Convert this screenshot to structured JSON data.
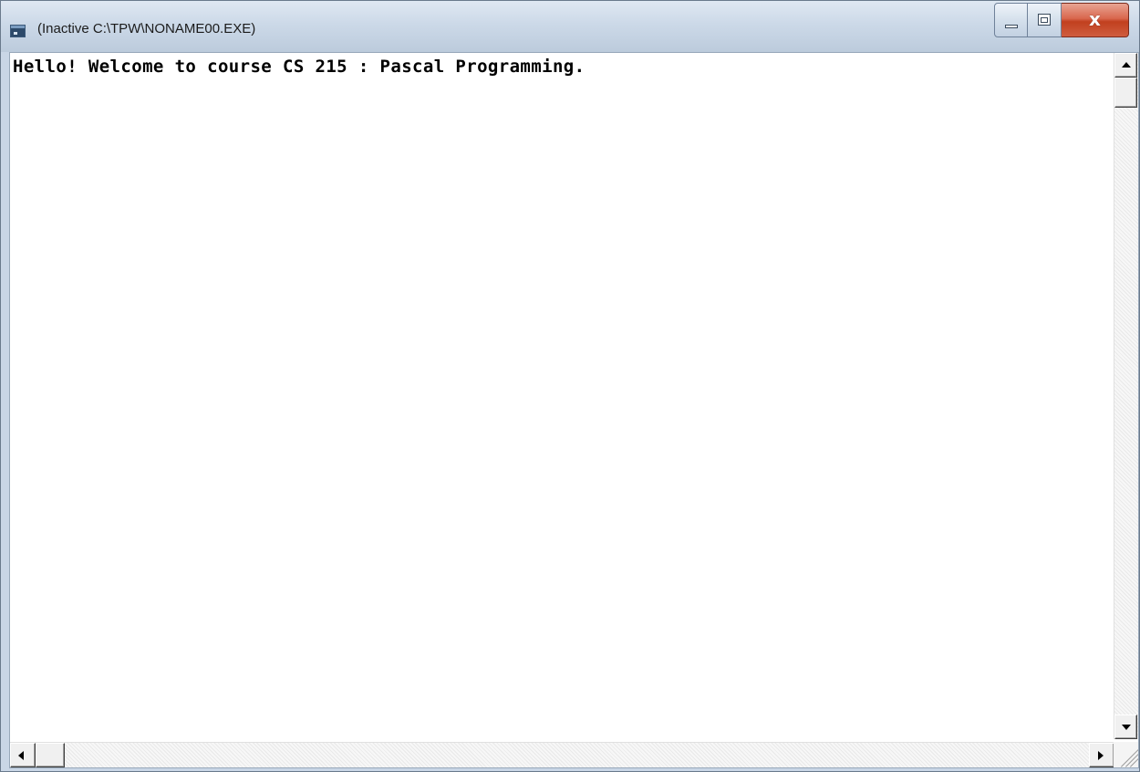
{
  "window": {
    "title": "(Inactive C:\\TPW\\NONAME00.EXE)",
    "icon": "console-app-icon",
    "controls": {
      "minimize": "minimize-icon",
      "maximize": "maximize-icon",
      "close": "close-icon",
      "close_glyph": "x"
    }
  },
  "console": {
    "output_lines": [
      "Hello! Welcome to course CS 215 : Pascal Programming."
    ]
  },
  "scrollbars": {
    "vertical": {
      "up_icon": "arrow-up-icon",
      "down_icon": "arrow-down-icon",
      "position": 0
    },
    "horizontal": {
      "left_icon": "arrow-left-icon",
      "right_icon": "arrow-right-icon",
      "position": 0
    }
  }
}
